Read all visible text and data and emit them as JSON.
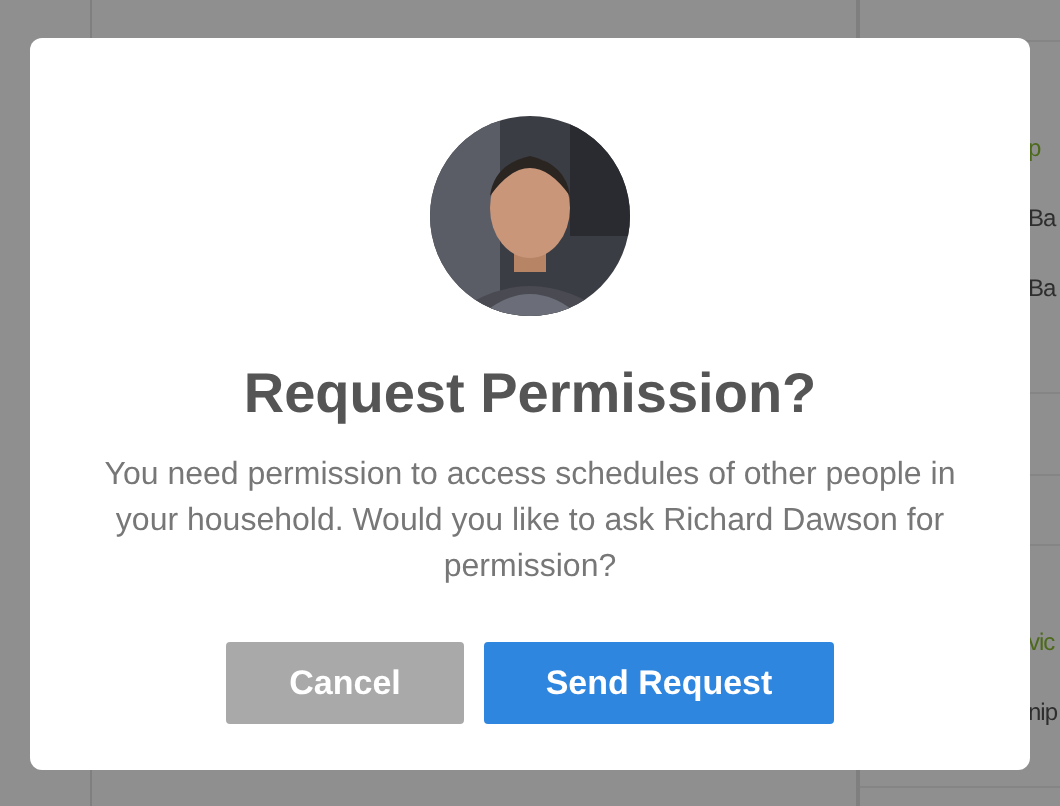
{
  "background": {
    "side_groups": [
      {
        "heading": "p",
        "items": [
          "Ba",
          "Ba"
        ]
      },
      {
        "heading": "vic",
        "items": [
          "nip"
        ]
      }
    ]
  },
  "dialog": {
    "title": "Request Permission?",
    "message": "You need permission to access schedules of other people in your household. Would you like to ask Richard Dawson for permission?",
    "buttons": [
      {
        "label": "Cancel",
        "kind": "secondary"
      },
      {
        "label": "Send Request",
        "kind": "primary"
      }
    ]
  }
}
